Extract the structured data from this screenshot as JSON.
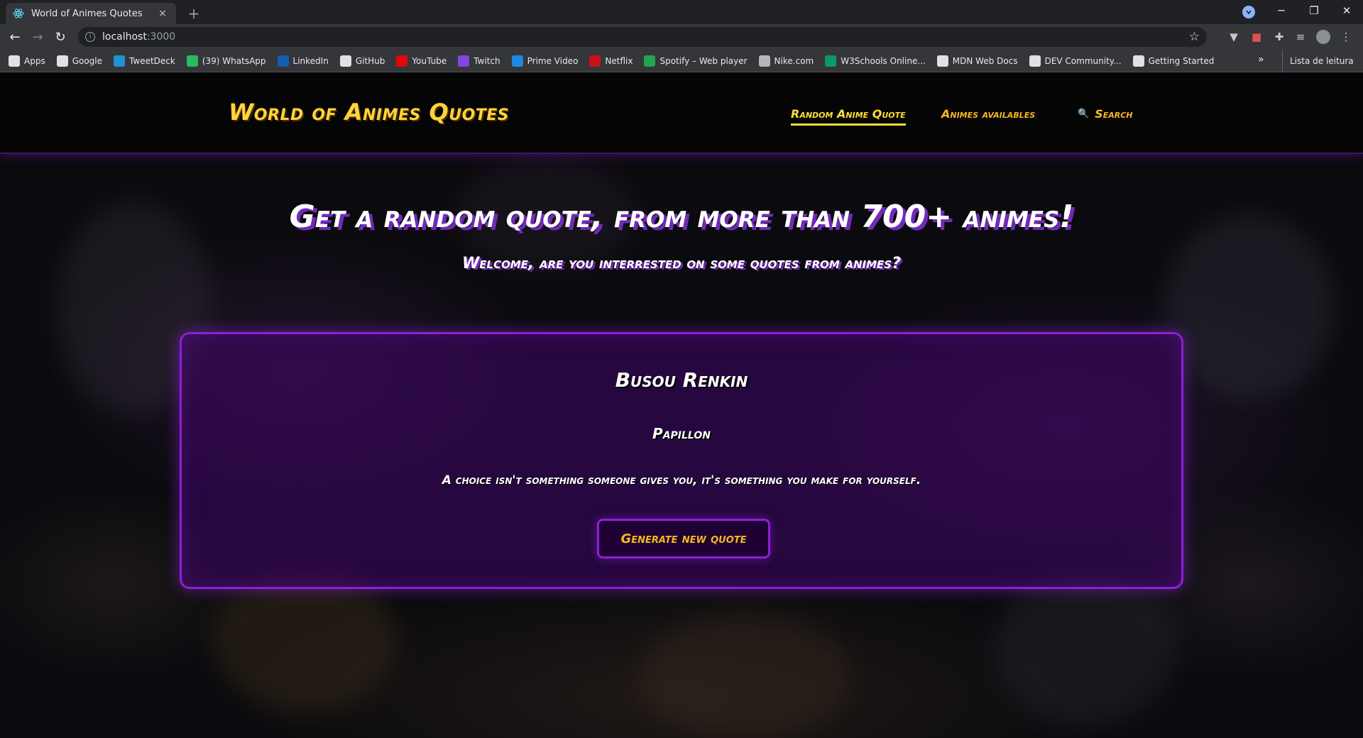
{
  "browser": {
    "tab_title": "World of Animes Quotes",
    "tab_close": "×",
    "new_tab": "+",
    "url_host": "localhost",
    "url_port": ":3000",
    "bookmarks": [
      {
        "label": "Apps",
        "icon": "apps-grid-icon",
        "color": "#ffffff"
      },
      {
        "label": "Google",
        "icon": "google-icon",
        "color": "#ffffff"
      },
      {
        "label": "TweetDeck",
        "icon": "tweetdeck-icon",
        "color": "#1da1f2"
      },
      {
        "label": "(39) WhatsApp",
        "icon": "whatsapp-icon",
        "color": "#25d366"
      },
      {
        "label": "LinkedIn",
        "icon": "linkedin-icon",
        "color": "#0a66c2"
      },
      {
        "label": "GitHub",
        "icon": "github-icon",
        "color": "#ffffff"
      },
      {
        "label": "YouTube",
        "icon": "youtube-icon",
        "color": "#ff0000"
      },
      {
        "label": "Twitch",
        "icon": "twitch-icon",
        "color": "#9146ff"
      },
      {
        "label": "Prime Video",
        "icon": "prime-video-icon",
        "color": "#1a98ff"
      },
      {
        "label": "Netflix",
        "icon": "netflix-icon",
        "color": "#e50914"
      },
      {
        "label": "Spotify – Web player",
        "icon": "spotify-icon",
        "color": "#1db954"
      },
      {
        "label": "Nike.com",
        "icon": "nike-icon",
        "color": "#cccccc"
      },
      {
        "label": "W3Schools Online...",
        "icon": "w3schools-icon",
        "color": "#04aa6d"
      },
      {
        "label": "MDN Web Docs",
        "icon": "mdn-icon",
        "color": "#ffffff"
      },
      {
        "label": "DEV Community...",
        "icon": "dev-icon",
        "color": "#ffffff"
      },
      {
        "label": "Getting Started",
        "icon": "getting-started-icon",
        "color": "#ffffff"
      }
    ],
    "bookmarks_more": "»",
    "reading_list": "Lista de leitura"
  },
  "site": {
    "logo": "World of Animes Quotes",
    "nav": {
      "random": "Random Anime Quote",
      "animes": "Animes availables",
      "search": "Search"
    }
  },
  "hero": {
    "title": "Get a random quote, from more than 700+ animes!",
    "subtitle": "Welcome, are you interrested on some quotes from animes?"
  },
  "quote": {
    "anime": "Busou Renkin",
    "character": "Papillon",
    "text": "A choice isn't something someone gives you, it's something you make for yourself.",
    "button": "Generate new quote"
  },
  "colors": {
    "accent_yellow": "#ffd43b",
    "accent_orange": "#f6b91e",
    "purple_border": "#8d1fd6",
    "title_shadow": "#6f2bb8"
  }
}
